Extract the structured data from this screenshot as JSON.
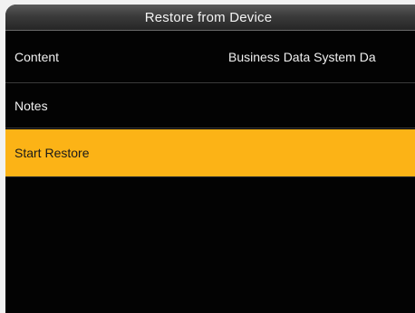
{
  "header": {
    "title": "Restore from Device"
  },
  "menu": {
    "items": [
      {
        "label": "Content",
        "value": "Business Data System Da"
      },
      {
        "label": "Notes",
        "value": ""
      },
      {
        "label": "Start Restore",
        "value": ""
      }
    ],
    "selected_index": 2
  },
  "colors": {
    "highlight": "#fcb316",
    "background": "#030303",
    "text": "#f0f0f0"
  }
}
